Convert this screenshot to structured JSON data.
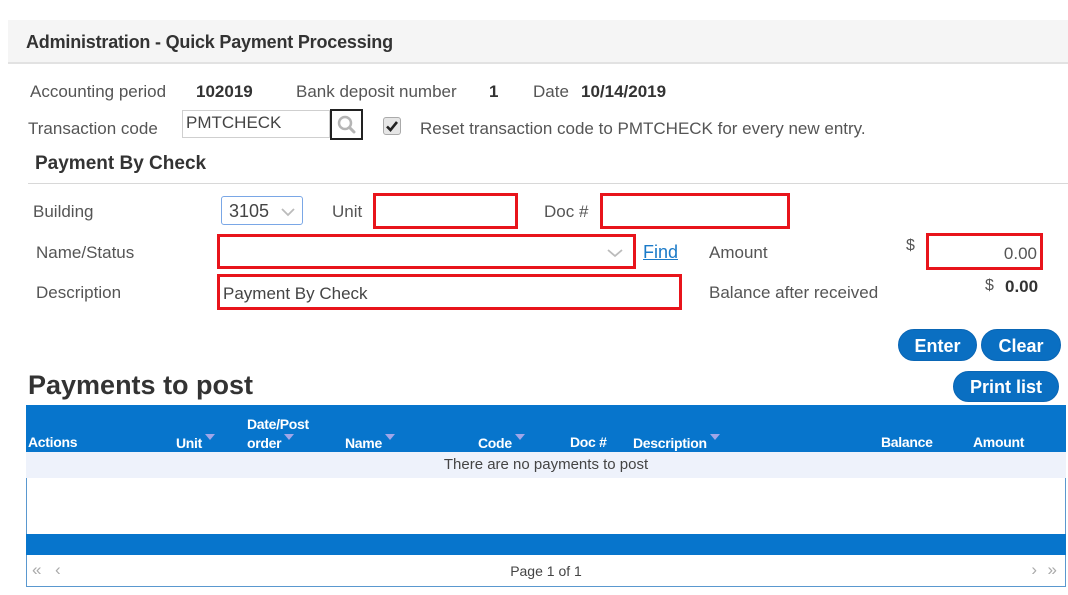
{
  "header": {
    "title": "Administration -  Quick Payment Processing"
  },
  "info": {
    "accounting_period_label": "Accounting period",
    "accounting_period_value": "102019",
    "bank_deposit_label": "Bank deposit number",
    "bank_deposit_value": "1",
    "date_label": "Date",
    "date_value": "10/14/2019",
    "transaction_code_label": "Transaction code",
    "transaction_code_value": "PMTCHECK",
    "reset_checkbox_checked": true,
    "reset_checkbox_label": "Reset transaction code to PMTCHECK for every new entry."
  },
  "form": {
    "section_title": "Payment By Check",
    "building_label": "Building",
    "building_value": "3105",
    "unit_label": "Unit",
    "unit_value": "",
    "doc_label": "Doc #",
    "doc_value": "",
    "name_status_label": "Name/Status",
    "name_status_value": "",
    "find_link": "Find",
    "amount_label": "Amount",
    "amount_currency": "$",
    "amount_value": "0.00",
    "description_label": "Description",
    "description_value": "Payment By Check",
    "balance_label": "Balance after received",
    "balance_currency": "$",
    "balance_value": "0.00",
    "enter_button": "Enter",
    "clear_button": "Clear"
  },
  "payments": {
    "title": "Payments to post",
    "print_button": "Print list",
    "columns": [
      {
        "label": "Actions",
        "sortable": false
      },
      {
        "label": "Unit",
        "sortable": true
      },
      {
        "label_line1": "Date/Post",
        "label": "order",
        "sortable": true
      },
      {
        "label": "Name",
        "sortable": true
      },
      {
        "label": "Code",
        "sortable": true
      },
      {
        "label": "Doc #",
        "sortable": false
      },
      {
        "label": "Description",
        "sortable": true
      },
      {
        "label": "Balance",
        "sortable": false
      },
      {
        "label": "Amount",
        "sortable": false
      }
    ],
    "empty_message": "There are no payments to post",
    "pager": {
      "text": "Page 1 of 1",
      "first": "«",
      "prev": "‹",
      "next": "›",
      "last": "»"
    }
  },
  "colors": {
    "accent": "#0775cc",
    "required_border": "#e8141b",
    "link": "#1a7ac8"
  }
}
